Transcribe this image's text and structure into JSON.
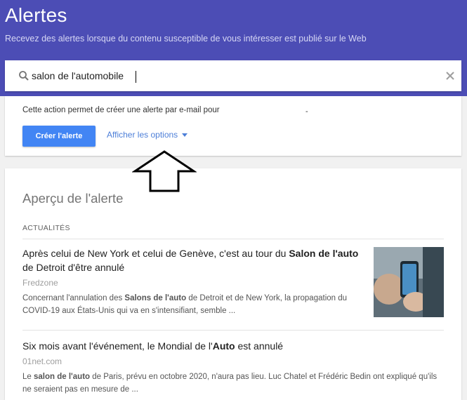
{
  "header": {
    "title": "Alertes",
    "subtitle": "Recevez des alertes lorsque du contenu susceptible de vous intéresser est publié sur le Web"
  },
  "search": {
    "value": "salon de l'automobile",
    "search_icon": "search-icon",
    "clear_icon": "close-icon"
  },
  "create_card": {
    "description": "Cette action permet de créer une alerte par e-mail pour",
    "dash": "-",
    "create_label": "Créer l'alerte",
    "options_label": "Afficher les options",
    "options_icon": "caret-down-icon"
  },
  "preview": {
    "title": "Aperçu de l'alerte",
    "section_label": "ACTUALITÉS",
    "items": [
      {
        "title_parts": [
          "Après celui de New York et celui de Genève, c'est au tour du ",
          "Salon de l'auto",
          " de Detroit d'être annulé"
        ],
        "source": "Fredzone",
        "snippet_parts": [
          "Concernant l'annulation des ",
          "Salons de l'auto",
          " de Detroit et de New York, la propagation du COVID-19 aux États-Unis qui va en s'intensifiant, semble ..."
        ],
        "has_thumbnail": true
      },
      {
        "title_parts": [
          "Six mois avant l'événement, le Mondial de l'",
          "Auto",
          " est annulé"
        ],
        "source": "01net.com",
        "snippet_parts": [
          "Le ",
          "salon de l'auto",
          " de Paris, prévu en octobre 2020, n'aura pas lieu. Luc Chatel et Frédéric Bedin ont expliqué qu'ils ne seraient pas en mesure de ..."
        ],
        "has_thumbnail": false
      }
    ]
  },
  "colors": {
    "header_bg": "#4c4db5",
    "accent": "#4285f4",
    "link": "#4d7fd8",
    "page_bg": "#f1f1f1"
  }
}
